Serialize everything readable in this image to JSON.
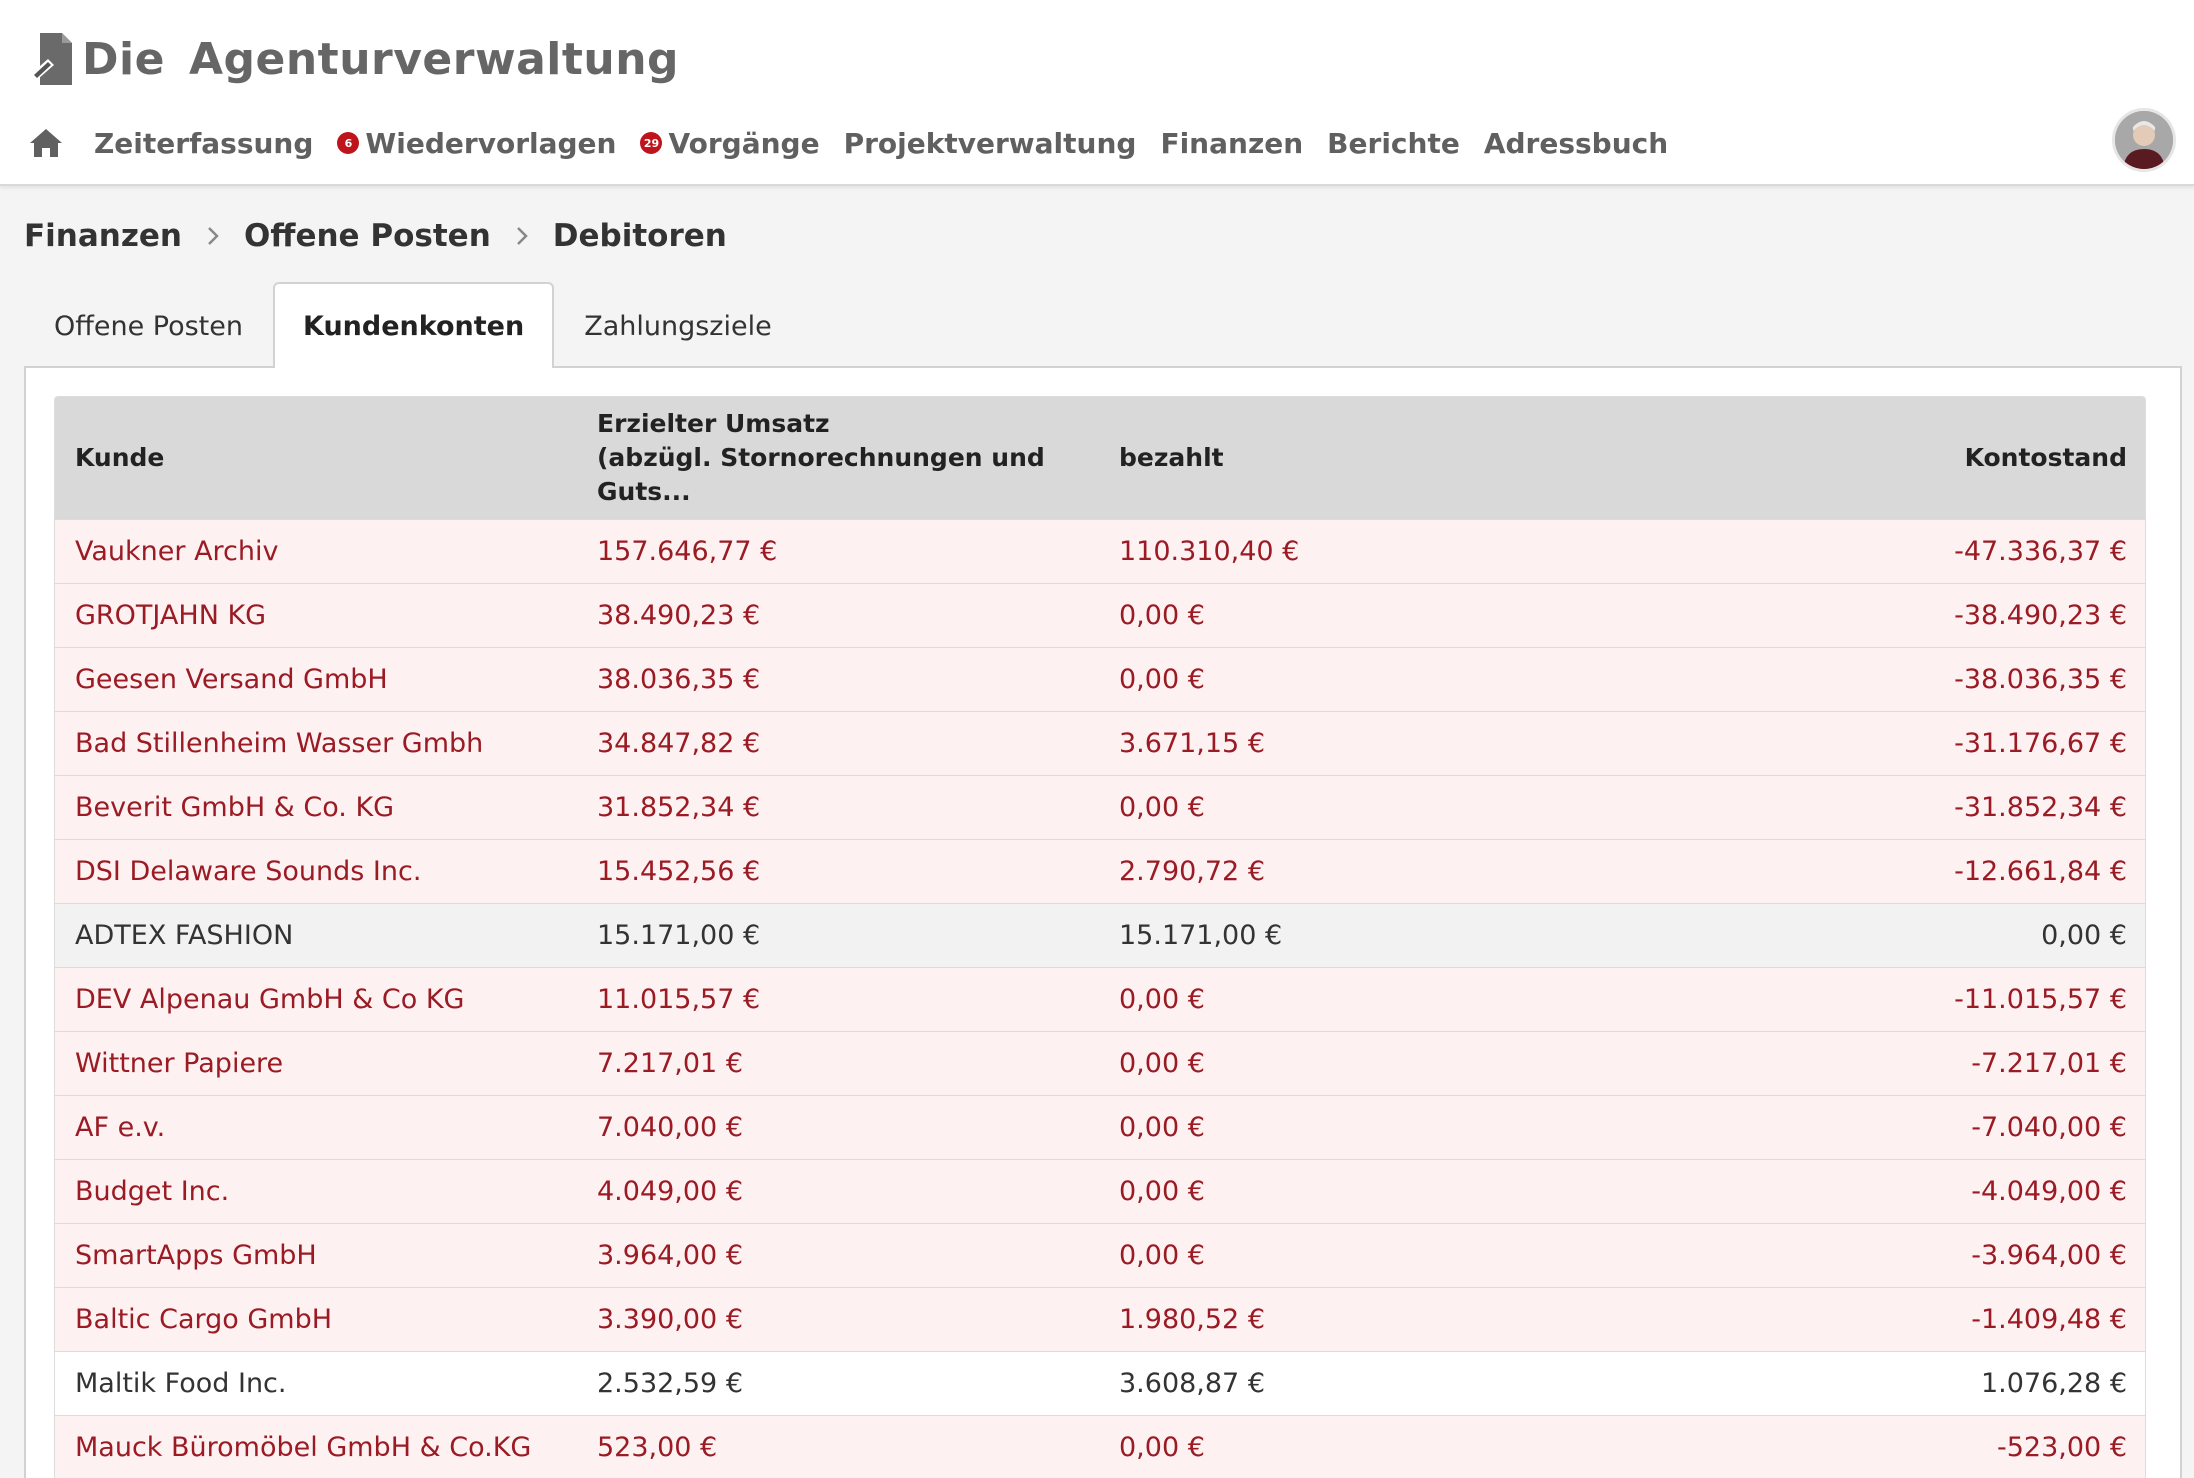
{
  "app": {
    "logo_word1": "Die",
    "logo_word2": "Agenturverwaltung"
  },
  "nav": {
    "home_icon": "home-icon",
    "items": [
      {
        "label": "Zeiterfassung",
        "badge": null
      },
      {
        "label": "Wiedervorlagen",
        "badge": "6"
      },
      {
        "label": "Vorgänge",
        "badge": "29"
      },
      {
        "label": "Projektverwaltung",
        "badge": null
      },
      {
        "label": "Finanzen",
        "badge": null
      },
      {
        "label": "Berichte",
        "badge": null
      },
      {
        "label": "Adressbuch",
        "badge": null
      }
    ]
  },
  "breadcrumb": [
    "Finanzen",
    "Offene Posten",
    "Debitoren"
  ],
  "tabs": [
    {
      "label": "Offene Posten",
      "active": false
    },
    {
      "label": "Kundenkonten",
      "active": true
    },
    {
      "label": "Zahlungsziele",
      "active": false
    }
  ],
  "table": {
    "headers": {
      "kunde": "Kunde",
      "umsatz_line1": "Erzielter Umsatz",
      "umsatz_line2": "(abzügl. Stornorechnungen und Guts...",
      "bezahlt": "bezahlt",
      "kontostand": "Kontostand"
    },
    "rows": [
      {
        "kunde": "Vaukner Archiv",
        "umsatz": "157.646,77 €",
        "bezahlt": "110.310,40 €",
        "kontostand": "-47.336,37 €",
        "status": "neg"
      },
      {
        "kunde": "GROTJAHN KG",
        "umsatz": "38.490,23 €",
        "bezahlt": "0,00 €",
        "kontostand": "-38.490,23 €",
        "status": "neg"
      },
      {
        "kunde": "Geesen Versand GmbH",
        "umsatz": "38.036,35 €",
        "bezahlt": "0,00 €",
        "kontostand": "-38.036,35 €",
        "status": "neg"
      },
      {
        "kunde": "Bad Stillenheim Wasser Gmbh",
        "umsatz": "34.847,82 €",
        "bezahlt": "3.671,15 €",
        "kontostand": "-31.176,67 €",
        "status": "neg"
      },
      {
        "kunde": "Beverit GmbH & Co. KG",
        "umsatz": "31.852,34 €",
        "bezahlt": "0,00 €",
        "kontostand": "-31.852,34 €",
        "status": "neg"
      },
      {
        "kunde": "DSI Delaware Sounds Inc.",
        "umsatz": "15.452,56 €",
        "bezahlt": "2.790,72 €",
        "kontostand": "-12.661,84 €",
        "status": "neg"
      },
      {
        "kunde": "ADTEX FASHION",
        "umsatz": "15.171,00 €",
        "bezahlt": "15.171,00 €",
        "kontostand": "0,00 €",
        "status": "neutral"
      },
      {
        "kunde": "DEV Alpenau GmbH & Co KG",
        "umsatz": "11.015,57 €",
        "bezahlt": "0,00 €",
        "kontostand": "-11.015,57 €",
        "status": "neg"
      },
      {
        "kunde": "Wittner Papiere",
        "umsatz": "7.217,01 €",
        "bezahlt": "0,00 €",
        "kontostand": "-7.217,01 €",
        "status": "neg"
      },
      {
        "kunde": "AF e.v.",
        "umsatz": "7.040,00 €",
        "bezahlt": "0,00 €",
        "kontostand": "-7.040,00 €",
        "status": "neg"
      },
      {
        "kunde": "Budget Inc.",
        "umsatz": "4.049,00 €",
        "bezahlt": "0,00 €",
        "kontostand": "-4.049,00 €",
        "status": "neg"
      },
      {
        "kunde": "SmartApps GmbH",
        "umsatz": "3.964,00 €",
        "bezahlt": "0,00 €",
        "kontostand": "-3.964,00 €",
        "status": "neg"
      },
      {
        "kunde": "Baltic Cargo GmbH",
        "umsatz": "3.390,00 €",
        "bezahlt": "1.980,52 €",
        "kontostand": "-1.409,48 €",
        "status": "neg"
      },
      {
        "kunde": "Maltik Food Inc.",
        "umsatz": "2.532,59 €",
        "bezahlt": "3.608,87 €",
        "kontostand": "1.076,28 €",
        "status": "pos"
      },
      {
        "kunde": "Mauck Büromöbel GmbH & Co.KG",
        "umsatz": "523,00 €",
        "bezahlt": "0,00 €",
        "kontostand": "-523,00 €",
        "status": "neg"
      }
    ]
  },
  "colors": {
    "negative_text": "#9b1b24",
    "negative_row_bg": "#fdf1f2",
    "neutral_row_bg": "#f2f2f2",
    "header_bg": "#d9d9d9",
    "badge_bg": "#c0141d"
  }
}
